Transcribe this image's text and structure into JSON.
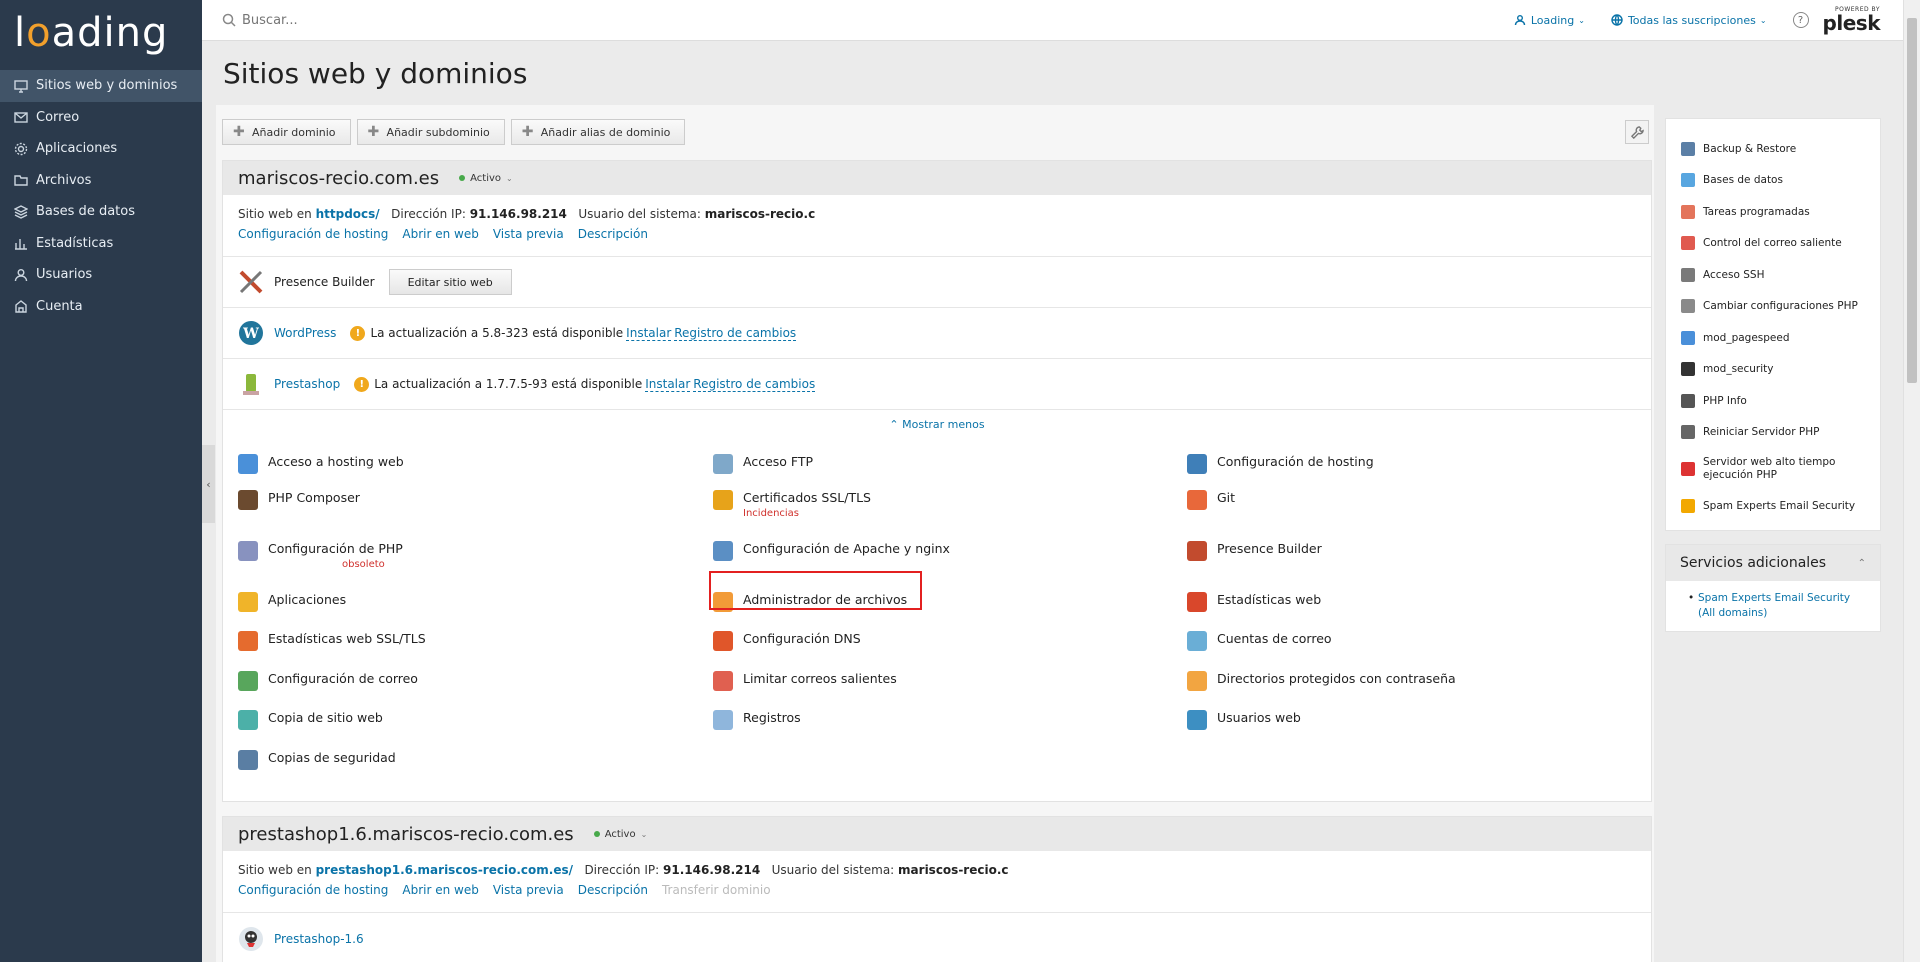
{
  "logo": {
    "before": "l",
    "o": "o",
    "after": "ading"
  },
  "sidebar": {
    "items": [
      {
        "label": "Sitios web y dominios",
        "icon": "monitor-icon"
      },
      {
        "label": "Correo",
        "icon": "mail-icon"
      },
      {
        "label": "Aplicaciones",
        "icon": "gear-icon"
      },
      {
        "label": "Archivos",
        "icon": "folder-icon"
      },
      {
        "label": "Bases de datos",
        "icon": "database-icon"
      },
      {
        "label": "Estadísticas",
        "icon": "bar-chart-icon"
      },
      {
        "label": "Usuarios",
        "icon": "user-icon"
      },
      {
        "label": "Cuenta",
        "icon": "account-icon"
      }
    ]
  },
  "topbar": {
    "search_placeholder": "Buscar...",
    "user_menu": "Loading",
    "subscriptions_menu": "Todas las suscripciones",
    "help": "?",
    "plesk_powered": "POWERED BY",
    "plesk_name": "plesk"
  },
  "page": {
    "title": "Sitios web y dominios"
  },
  "toolbar": {
    "add_domain": "Añadir dominio",
    "add_subdomain": "Añadir subdominio",
    "add_alias": "Añadir alias de dominio"
  },
  "domain1": {
    "name": "mariscos-recio.com.es",
    "status": "Activo",
    "site_label": "Sitio web en",
    "site_value": "httpdocs/",
    "ip_label": "Dirección IP:",
    "ip_value": "91.146.98.214",
    "user_label": "Usuario del sistema:",
    "user_value": "mariscos-recio.c",
    "links": [
      "Configuración de hosting",
      "Abrir en web",
      "Vista previa",
      "Descripción"
    ],
    "presence_builder": "Presence Builder",
    "edit_site": "Editar sitio web",
    "wordpress": "WordPress",
    "wp_update": "La actualización a 5.8-323 está disponible",
    "prestashop": "Prestashop",
    "ps_update": "La actualización a 1.7.7.5-93 está disponible",
    "install": "Instalar",
    "changelog": "Registro de cambios",
    "show_less": "Mostrar menos",
    "warn_symbol": "!"
  },
  "tools": [
    {
      "label": "Acceso a hosting web",
      "color": "#4a90d9"
    },
    {
      "label": "Acceso FTP",
      "color": "#7fa8c9"
    },
    {
      "label": "Configuración de hosting",
      "color": "#3f7fb8"
    },
    {
      "label": "PHP Composer",
      "color": "#6b4a2f"
    },
    {
      "label": "Certificados SSL/TLS",
      "color": "#e7a31a",
      "sub": "Incidencias"
    },
    {
      "label": "Git",
      "color": "#e8683a"
    },
    {
      "label": "Configuración de PHP",
      "color": "#8892bf",
      "sub": "obsoleto"
    },
    {
      "label": "Configuración de Apache y nginx",
      "color": "#5b8fc4"
    },
    {
      "label": "Presence Builder",
      "color": "#c24b2e"
    },
    {
      "label": "Aplicaciones",
      "color": "#f0b429"
    },
    {
      "label": "Administrador de archivos",
      "color": "#f29b38"
    },
    {
      "label": "Estadísticas web",
      "color": "#d9472b"
    },
    {
      "label": "Estadísticas web SSL/TLS",
      "color": "#e56b2e"
    },
    {
      "label": "Configuración DNS",
      "color": "#e0562a"
    },
    {
      "label": "Cuentas de correo",
      "color": "#6aaed6"
    },
    {
      "label": "Configuración de correo",
      "color": "#58a65c"
    },
    {
      "label": "Limitar correos salientes",
      "color": "#e06050"
    },
    {
      "label": "Directorios protegidos con contraseña",
      "color": "#f2a541"
    },
    {
      "label": "Copia de sitio web",
      "color": "#4cb0a8"
    },
    {
      "label": "Registros",
      "color": "#8fb6dc"
    },
    {
      "label": "Usuarios web",
      "color": "#3d8fc2"
    },
    {
      "label": "Copias de seguridad",
      "color": "#5a7ea3"
    }
  ],
  "domain2": {
    "name": "prestashop1.6.mariscos-recio.com.es",
    "status": "Activo",
    "site_label": "Sitio web en",
    "site_value": "prestashop1.6.mariscos-recio.com.es/",
    "ip_label": "Dirección IP:",
    "ip_value": "91.146.98.214",
    "user_label": "Usuario del sistema:",
    "user_value": "mariscos-recio.c",
    "links": [
      "Configuración de hosting",
      "Abrir en web",
      "Vista previa",
      "Descripción"
    ],
    "disabled_link": "Transferir dominio",
    "app": "Prestashop-1.6"
  },
  "right_panel": {
    "items": [
      {
        "label": "Backup & Restore",
        "color": "#5b7fa6"
      },
      {
        "label": "Bases de datos",
        "color": "#58a6e0"
      },
      {
        "label": "Tareas programadas",
        "color": "#e3745b"
      },
      {
        "label": "Control del correo saliente",
        "color": "#e05a4f"
      },
      {
        "label": "Acceso SSH",
        "color": "#7a7a7a"
      },
      {
        "label": "Cambiar configuraciones PHP",
        "color": "#8a8a8a"
      },
      {
        "label": "mod_pagespeed",
        "color": "#4a8fd9"
      },
      {
        "label": "mod_security",
        "color": "#333"
      },
      {
        "label": "PHP Info",
        "color": "#555"
      },
      {
        "label": "Reiniciar Servidor PHP",
        "color": "#666"
      },
      {
        "label": "Servidor web alto tiempo ejecución PHP",
        "color": "#d33"
      },
      {
        "label": "Spam Experts Email Security",
        "color": "#f2a800"
      }
    ]
  },
  "services": {
    "title": "Servicios adicionales",
    "items": [
      "Spam Experts Email Security (All domains)"
    ]
  }
}
